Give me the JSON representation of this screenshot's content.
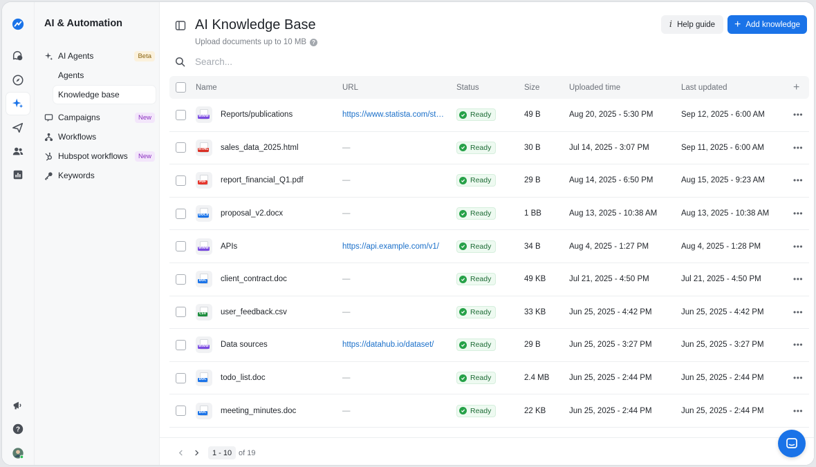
{
  "sidebar": {
    "title": "AI & Automation",
    "items": [
      {
        "label": "AI Agents",
        "badge": "Beta",
        "icon": "sparkle-icon"
      },
      {
        "label": "Agents"
      },
      {
        "label": "Knowledge base"
      },
      {
        "label": "Campaigns",
        "badge": "New",
        "icon": "campaign-icon"
      },
      {
        "label": "Workflows",
        "icon": "workflow-icon"
      },
      {
        "label": "Hubspot workflows",
        "badge": "New",
        "icon": "hubspot-icon"
      },
      {
        "label": "Keywords",
        "icon": "key-icon"
      }
    ]
  },
  "header": {
    "title": "AI Knowledge Base",
    "subtitle": "Upload documents up to 10 MB",
    "help_label": "Help guide",
    "add_label": "Add knowledge"
  },
  "search": {
    "placeholder": "Search..."
  },
  "table": {
    "columns": [
      "Name",
      "URL",
      "Status",
      "Size",
      "Uploaded time",
      "Last updated"
    ],
    "rows": [
      {
        "name": "Reports/publications",
        "type": "WWW",
        "tagColor": "#7b4be0",
        "url": "https://www.statista.com/statistics/",
        "status": "Ready",
        "size": "49 B",
        "uploaded": "Aug 20, 2025 - 5:30 PM",
        "updated": "Sep 12, 2025 - 6:00 AM"
      },
      {
        "name": "sales_data_2025.html",
        "type": "HTML",
        "tagColor": "#d93025",
        "url": "—",
        "status": "Ready",
        "size": "30 B",
        "uploaded": "Jul 14, 2025 - 3:07 PM",
        "updated": "Sep 11, 2025 - 6:00 AM"
      },
      {
        "name": "report_financial_Q1.pdf",
        "type": "PDF",
        "tagColor": "#e5352b",
        "url": "—",
        "status": "Ready",
        "size": "29 B",
        "uploaded": "Aug 14, 2025 - 6:50 PM",
        "updated": "Aug 15, 2025 - 9:23 AM"
      },
      {
        "name": "proposal_v2.docx",
        "type": "DOCX",
        "tagColor": "#1a73e8",
        "url": "—",
        "status": "Ready",
        "size": "1 BB",
        "uploaded": "Aug 13, 2025 - 10:38 AM",
        "updated": "Aug 13, 2025 - 10:38 AM"
      },
      {
        "name": "APIs",
        "type": "WWW",
        "tagColor": "#7b4be0",
        "url": "https://api.example.com/v1/",
        "status": "Ready",
        "size": "34 B",
        "uploaded": "Aug 4, 2025 - 1:27 PM",
        "updated": "Aug 4, 2025 - 1:28 PM"
      },
      {
        "name": "client_contract.doc",
        "type": "DOC",
        "tagColor": "#1a73e8",
        "url": "—",
        "status": "Ready",
        "size": "49 KB",
        "uploaded": "Jul 21, 2025 - 4:50 PM",
        "updated": "Jul 21, 2025 - 4:50 PM"
      },
      {
        "name": "user_feedback.csv",
        "type": "CSV",
        "tagColor": "#1e8e3e",
        "url": "—",
        "status": "Ready",
        "size": "33 KB",
        "uploaded": "Jun 25, 2025 - 4:42 PM",
        "updated": "Jun 25, 2025 - 4:42 PM"
      },
      {
        "name": "Data sources",
        "type": "WWW",
        "tagColor": "#7b4be0",
        "url": "https://datahub.io/dataset/",
        "status": "Ready",
        "size": "29 B",
        "uploaded": "Jun 25, 2025 - 3:27 PM",
        "updated": "Jun 25, 2025 - 3:27 PM"
      },
      {
        "name": "todo_list.doc",
        "type": "DOC",
        "tagColor": "#1a73e8",
        "url": "—",
        "status": "Ready",
        "size": "2.4 MB",
        "uploaded": "Jun 25, 2025 - 2:44 PM",
        "updated": "Jun 25, 2025 - 2:44 PM"
      },
      {
        "name": "meeting_minutes.doc",
        "type": "DOC",
        "tagColor": "#1a73e8",
        "url": "—",
        "status": "Ready",
        "size": "22 KB",
        "uploaded": "Jun 25, 2025 - 2:44 PM",
        "updated": "Jun 25, 2025 - 2:44 PM"
      }
    ]
  },
  "pagination": {
    "range": "1 - 10",
    "total": "of 19"
  },
  "colors": {
    "accent": "#1a73e8",
    "ready": "#26a148",
    "link": "#1a6fc9"
  }
}
